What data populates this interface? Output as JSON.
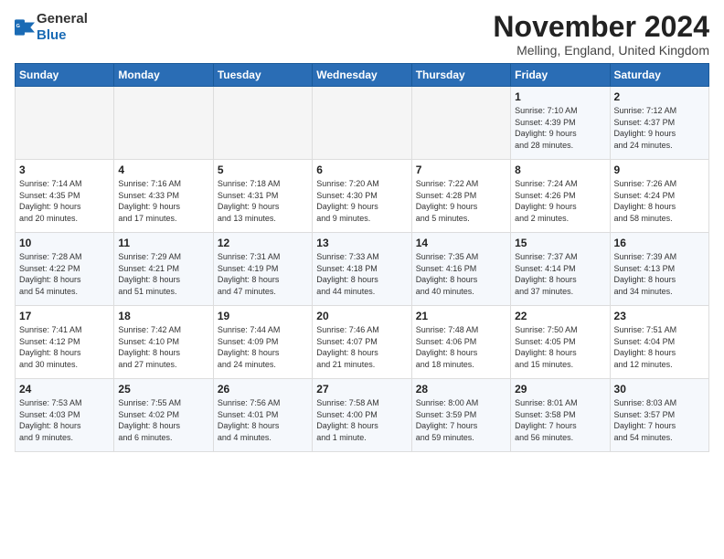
{
  "header": {
    "logo_general": "General",
    "logo_blue": "Blue",
    "month_title": "November 2024",
    "location": "Melling, England, United Kingdom"
  },
  "weekdays": [
    "Sunday",
    "Monday",
    "Tuesday",
    "Wednesday",
    "Thursday",
    "Friday",
    "Saturday"
  ],
  "weeks": [
    [
      {
        "day": "",
        "info": ""
      },
      {
        "day": "",
        "info": ""
      },
      {
        "day": "",
        "info": ""
      },
      {
        "day": "",
        "info": ""
      },
      {
        "day": "",
        "info": ""
      },
      {
        "day": "1",
        "info": "Sunrise: 7:10 AM\nSunset: 4:39 PM\nDaylight: 9 hours\nand 28 minutes."
      },
      {
        "day": "2",
        "info": "Sunrise: 7:12 AM\nSunset: 4:37 PM\nDaylight: 9 hours\nand 24 minutes."
      }
    ],
    [
      {
        "day": "3",
        "info": "Sunrise: 7:14 AM\nSunset: 4:35 PM\nDaylight: 9 hours\nand 20 minutes."
      },
      {
        "day": "4",
        "info": "Sunrise: 7:16 AM\nSunset: 4:33 PM\nDaylight: 9 hours\nand 17 minutes."
      },
      {
        "day": "5",
        "info": "Sunrise: 7:18 AM\nSunset: 4:31 PM\nDaylight: 9 hours\nand 13 minutes."
      },
      {
        "day": "6",
        "info": "Sunrise: 7:20 AM\nSunset: 4:30 PM\nDaylight: 9 hours\nand 9 minutes."
      },
      {
        "day": "7",
        "info": "Sunrise: 7:22 AM\nSunset: 4:28 PM\nDaylight: 9 hours\nand 5 minutes."
      },
      {
        "day": "8",
        "info": "Sunrise: 7:24 AM\nSunset: 4:26 PM\nDaylight: 9 hours\nand 2 minutes."
      },
      {
        "day": "9",
        "info": "Sunrise: 7:26 AM\nSunset: 4:24 PM\nDaylight: 8 hours\nand 58 minutes."
      }
    ],
    [
      {
        "day": "10",
        "info": "Sunrise: 7:28 AM\nSunset: 4:22 PM\nDaylight: 8 hours\nand 54 minutes."
      },
      {
        "day": "11",
        "info": "Sunrise: 7:29 AM\nSunset: 4:21 PM\nDaylight: 8 hours\nand 51 minutes."
      },
      {
        "day": "12",
        "info": "Sunrise: 7:31 AM\nSunset: 4:19 PM\nDaylight: 8 hours\nand 47 minutes."
      },
      {
        "day": "13",
        "info": "Sunrise: 7:33 AM\nSunset: 4:18 PM\nDaylight: 8 hours\nand 44 minutes."
      },
      {
        "day": "14",
        "info": "Sunrise: 7:35 AM\nSunset: 4:16 PM\nDaylight: 8 hours\nand 40 minutes."
      },
      {
        "day": "15",
        "info": "Sunrise: 7:37 AM\nSunset: 4:14 PM\nDaylight: 8 hours\nand 37 minutes."
      },
      {
        "day": "16",
        "info": "Sunrise: 7:39 AM\nSunset: 4:13 PM\nDaylight: 8 hours\nand 34 minutes."
      }
    ],
    [
      {
        "day": "17",
        "info": "Sunrise: 7:41 AM\nSunset: 4:12 PM\nDaylight: 8 hours\nand 30 minutes."
      },
      {
        "day": "18",
        "info": "Sunrise: 7:42 AM\nSunset: 4:10 PM\nDaylight: 8 hours\nand 27 minutes."
      },
      {
        "day": "19",
        "info": "Sunrise: 7:44 AM\nSunset: 4:09 PM\nDaylight: 8 hours\nand 24 minutes."
      },
      {
        "day": "20",
        "info": "Sunrise: 7:46 AM\nSunset: 4:07 PM\nDaylight: 8 hours\nand 21 minutes."
      },
      {
        "day": "21",
        "info": "Sunrise: 7:48 AM\nSunset: 4:06 PM\nDaylight: 8 hours\nand 18 minutes."
      },
      {
        "day": "22",
        "info": "Sunrise: 7:50 AM\nSunset: 4:05 PM\nDaylight: 8 hours\nand 15 minutes."
      },
      {
        "day": "23",
        "info": "Sunrise: 7:51 AM\nSunset: 4:04 PM\nDaylight: 8 hours\nand 12 minutes."
      }
    ],
    [
      {
        "day": "24",
        "info": "Sunrise: 7:53 AM\nSunset: 4:03 PM\nDaylight: 8 hours\nand 9 minutes."
      },
      {
        "day": "25",
        "info": "Sunrise: 7:55 AM\nSunset: 4:02 PM\nDaylight: 8 hours\nand 6 minutes."
      },
      {
        "day": "26",
        "info": "Sunrise: 7:56 AM\nSunset: 4:01 PM\nDaylight: 8 hours\nand 4 minutes."
      },
      {
        "day": "27",
        "info": "Sunrise: 7:58 AM\nSunset: 4:00 PM\nDaylight: 8 hours\nand 1 minute."
      },
      {
        "day": "28",
        "info": "Sunrise: 8:00 AM\nSunset: 3:59 PM\nDaylight: 7 hours\nand 59 minutes."
      },
      {
        "day": "29",
        "info": "Sunrise: 8:01 AM\nSunset: 3:58 PM\nDaylight: 7 hours\nand 56 minutes."
      },
      {
        "day": "30",
        "info": "Sunrise: 8:03 AM\nSunset: 3:57 PM\nDaylight: 7 hours\nand 54 minutes."
      }
    ]
  ]
}
